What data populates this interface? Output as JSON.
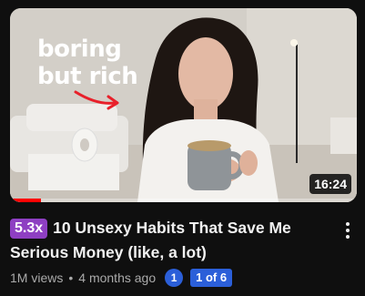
{
  "video": {
    "thumbnail_text_line1": "boring",
    "thumbnail_text_line2": "but rich",
    "duration": "16:24",
    "watch_progress": 0.09,
    "speed_badge": "5.3x",
    "title": "10 Unsexy Habits That Save Me Serious Money (like, a lot)",
    "views": "1M views",
    "separator": "•",
    "age": "4 months ago",
    "count_badge": "1",
    "part_badge": "1 of 6"
  },
  "colors": {
    "speed_badge": "#8e3fc2",
    "count_badge": "#2b5fd9",
    "progress": "#ff0000"
  },
  "icons": {
    "more": "more-vertical-icon",
    "arrow": "curved-arrow-icon"
  }
}
